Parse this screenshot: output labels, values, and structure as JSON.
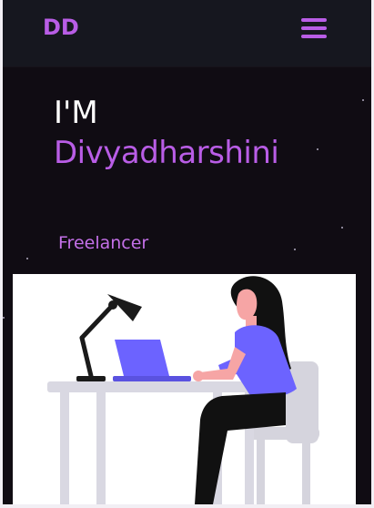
{
  "navbar": {
    "logo": "DD",
    "menu_icon": "hamburger-menu-icon"
  },
  "hero": {
    "intro": "I'M",
    "name": "Divyadharshini",
    "role": "Freelancer",
    "illustration": "woman-working-at-desk-illustration"
  },
  "colors": {
    "accent": "#b95de6",
    "background": "#100c13",
    "navbar": "#16171f",
    "laptop": "#6c63ff"
  }
}
